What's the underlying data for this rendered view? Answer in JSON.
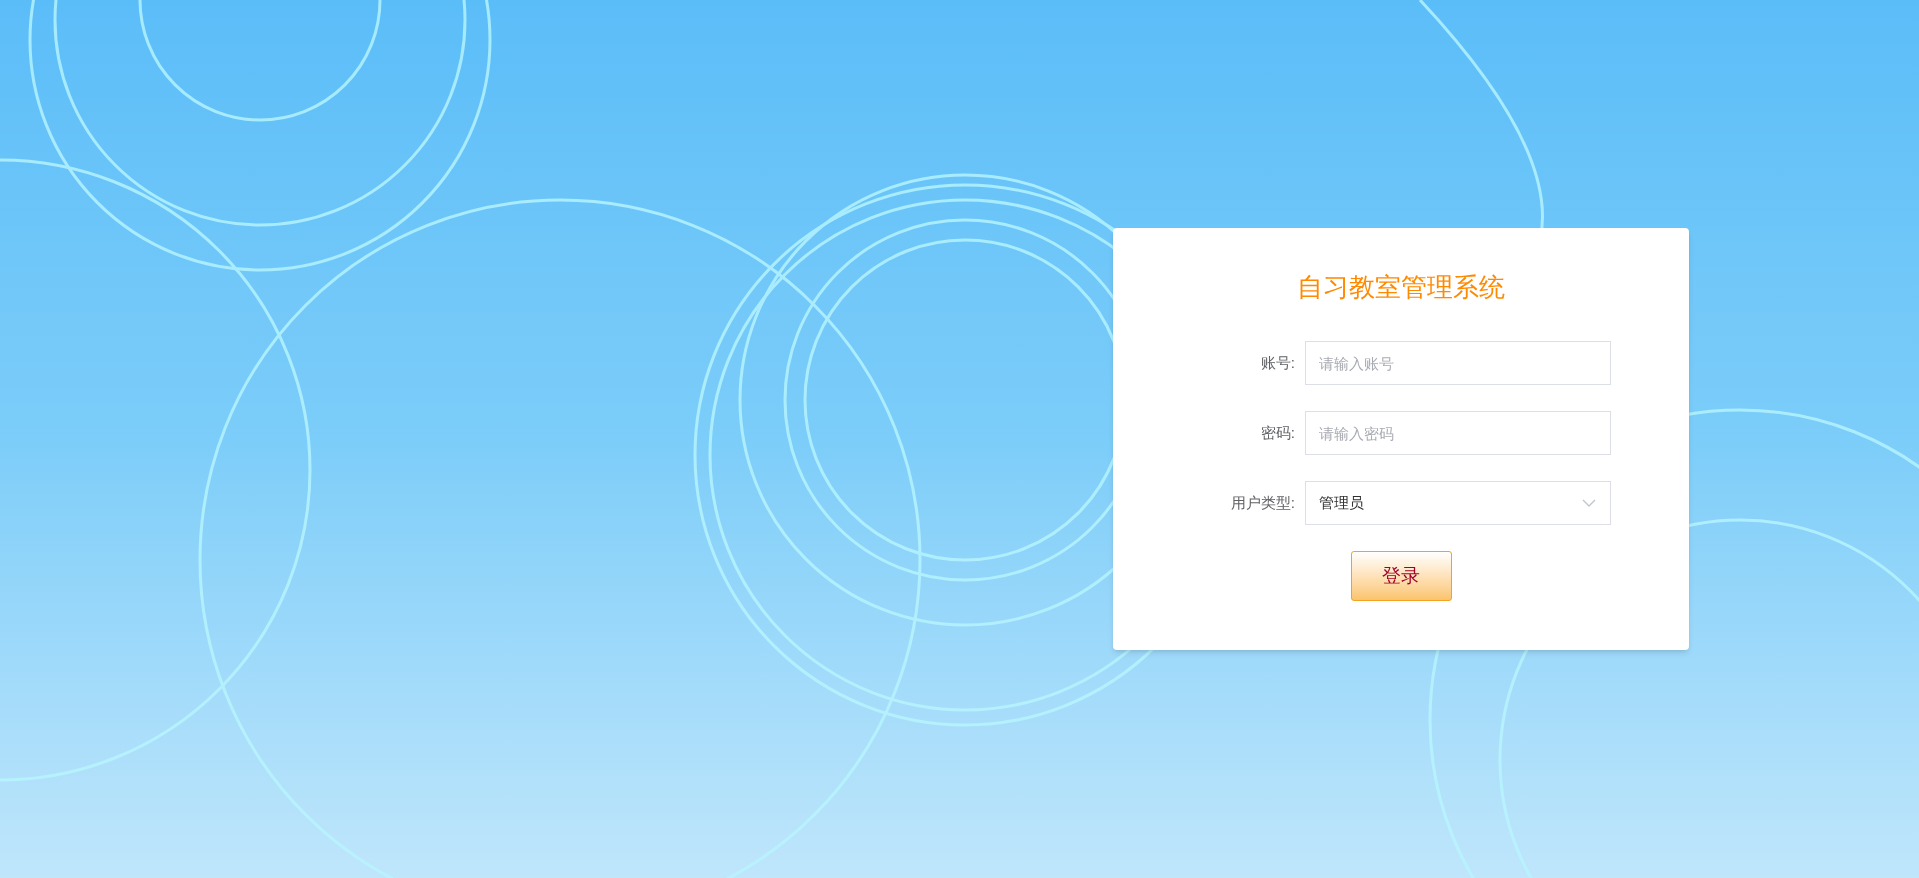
{
  "login_card": {
    "title": "自习教室管理系统",
    "fields": [
      {
        "kind": "text",
        "label": "账号:",
        "placeholder": "请输入账号"
      },
      {
        "kind": "password",
        "label": "密码:",
        "placeholder": "请输入密码"
      },
      {
        "kind": "select",
        "label": "用户类型:",
        "value": "管理员"
      }
    ],
    "submit_button": "登录"
  }
}
